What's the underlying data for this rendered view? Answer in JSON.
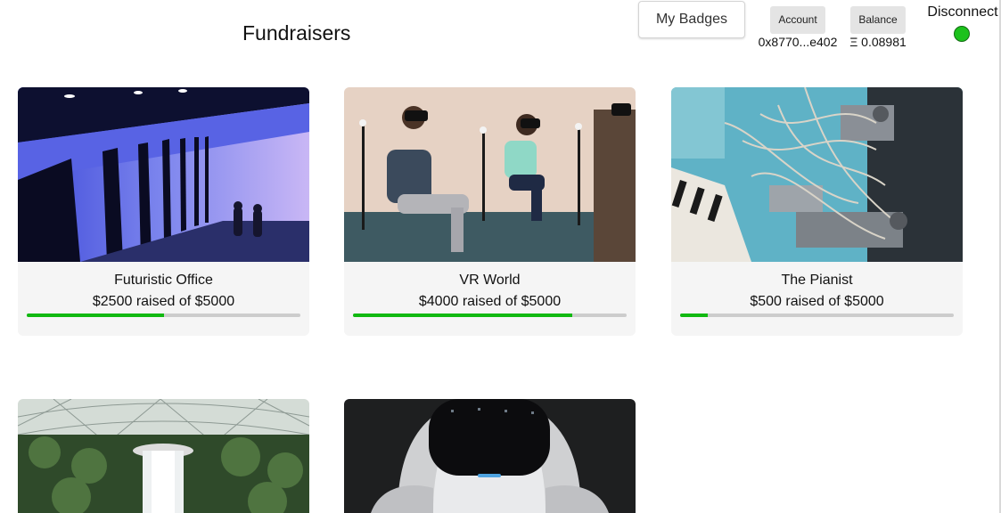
{
  "header": {
    "title": "Fundraisers",
    "badges_button": "My Badges",
    "account_label": "Account",
    "account_value": "0x8770...e402",
    "balance_label": "Balance",
    "balance_value": "Ξ 0.08981",
    "disconnect_label": "Disconnect",
    "status_color": "#1cc21c"
  },
  "fundraisers": [
    {
      "title": "Futuristic Office",
      "raised_text": "$2500 raised of $5000",
      "raised": 2500,
      "goal": 5000,
      "image": "tunnel-photo"
    },
    {
      "title": "VR World",
      "raised_text": "$4000 raised of $5000",
      "raised": 4000,
      "goal": 5000,
      "image": "vr-photo"
    },
    {
      "title": "The Pianist",
      "raised_text": "$500 raised of $5000",
      "raised": 500,
      "goal": 5000,
      "image": "robot-piano-photo"
    },
    {
      "title": "",
      "raised_text": "",
      "raised": null,
      "goal": null,
      "image": "waterfall-photo"
    },
    {
      "title": "",
      "raised_text": "",
      "raised": null,
      "goal": null,
      "image": "robot-head-photo"
    }
  ],
  "colors": {
    "progress_fill": "#11b911",
    "progress_track": "#cccccc",
    "card_background": "#f5f5f5"
  }
}
